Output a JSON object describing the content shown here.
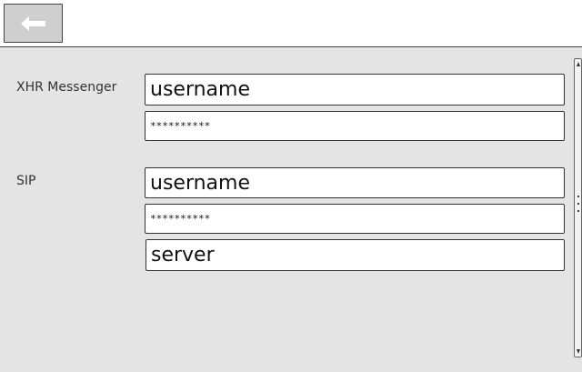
{
  "header": {
    "back_button": {
      "icon": "arrow-left-icon"
    }
  },
  "accounts": {
    "xhr": {
      "label": "XHR Messenger",
      "username": "username",
      "password": "**********"
    },
    "sip": {
      "label": "SIP",
      "username": "username",
      "password": "**********",
      "server": "server"
    }
  }
}
